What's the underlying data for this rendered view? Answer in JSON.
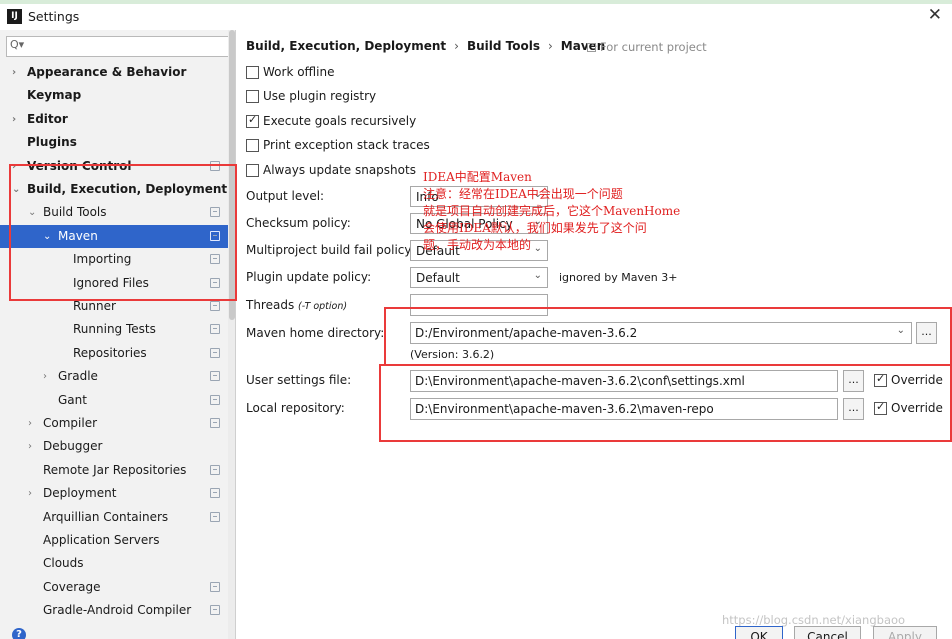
{
  "window": {
    "title": "Settings",
    "app_icon": "IJ"
  },
  "sidebar": {
    "search_placeholder": "Q▾",
    "items": [
      {
        "label": "Appearance & Behavior",
        "bold": true,
        "arrow": "›",
        "level": 0
      },
      {
        "label": "Keymap",
        "bold": true,
        "level": 0
      },
      {
        "label": "Editor",
        "bold": true,
        "arrow": "›",
        "level": 0
      },
      {
        "label": "Plugins",
        "bold": true,
        "level": 0
      },
      {
        "label": "Version Control",
        "bold": true,
        "arrow": "›",
        "level": 0,
        "project": true
      },
      {
        "label": "Build, Execution, Deployment",
        "bold": true,
        "arrow": "⌄",
        "level": 0
      },
      {
        "label": "Build Tools",
        "arrow": "⌄",
        "level": 1,
        "project": true
      },
      {
        "label": "Maven",
        "arrow": "⌄",
        "level": 2,
        "project": true,
        "selected": true
      },
      {
        "label": "Importing",
        "level": 3,
        "project": true
      },
      {
        "label": "Ignored Files",
        "level": 3,
        "project": true
      },
      {
        "label": "Runner",
        "level": 3,
        "project": true
      },
      {
        "label": "Running Tests",
        "level": 3,
        "project": true
      },
      {
        "label": "Repositories",
        "level": 3,
        "project": true
      },
      {
        "label": "Gradle",
        "arrow": "›",
        "level": 2,
        "project": true
      },
      {
        "label": "Gant",
        "level": 2,
        "project": true
      },
      {
        "label": "Compiler",
        "arrow": "›",
        "level": 1,
        "project": true
      },
      {
        "label": "Debugger",
        "arrow": "›",
        "level": 1
      },
      {
        "label": "Remote Jar Repositories",
        "level": 1,
        "project": true
      },
      {
        "label": "Deployment",
        "arrow": "›",
        "level": 1,
        "project": true
      },
      {
        "label": "Arquillian Containers",
        "level": 1,
        "project": true
      },
      {
        "label": "Application Servers",
        "level": 1
      },
      {
        "label": "Clouds",
        "level": 1
      },
      {
        "label": "Coverage",
        "level": 1,
        "project": true
      },
      {
        "label": "Gradle-Android Compiler",
        "level": 1,
        "project": true
      }
    ]
  },
  "breadcrumb": {
    "parts": [
      "Build, Execution, Deployment",
      "Build Tools",
      "Maven"
    ],
    "separator": "›",
    "note": "For current project"
  },
  "options": [
    {
      "label": "Work offline",
      "checked": false
    },
    {
      "label": "Use plugin registry",
      "checked": false
    },
    {
      "label": "Execute goals recursively",
      "checked": true
    },
    {
      "label": "Print exception stack traces",
      "checked": false
    },
    {
      "label": "Always update snapshots",
      "checked": false
    }
  ],
  "fields": {
    "output_level": {
      "label": "Output level:",
      "value": "Info"
    },
    "checksum_policy": {
      "label": "Checksum policy:",
      "value": "No Global Policy"
    },
    "multiproject_policy": {
      "label": "Multiproject build fail policy:",
      "value": "Default"
    },
    "plugin_update_policy": {
      "label": "Plugin update policy:",
      "value": "Default",
      "note": "ignored by Maven 3+"
    },
    "threads": {
      "label": "Threads",
      "hint": "(-T option)",
      "value": ""
    },
    "maven_home": {
      "label": "Maven home directory:",
      "value": "D:/Environment/apache-maven-3.6.2",
      "version": "(Version: 3.6.2)"
    },
    "user_settings": {
      "label": "User settings file:",
      "value": "D:\\Environment\\apache-maven-3.6.2\\conf\\settings.xml",
      "override_label": "Override",
      "override": true
    },
    "local_repo": {
      "label": "Local repository:",
      "value": "D:\\Environment\\apache-maven-3.6.2\\maven-repo",
      "override_label": "Override",
      "override": true
    }
  },
  "browse_label": "...",
  "annotation": "IDEA中配置Maven\n注意：经常在IDEA中会出现一个问题\n就是项目自动创建完成后，它这个MavenHome\n会使用IDEA默认，我们如果发先了这个问\n题，手动改为本地的",
  "buttons": {
    "ok": "OK",
    "cancel": "Cancel",
    "apply": "Apply",
    "help": "?"
  },
  "watermark": "https://blog.csdn.net/xiangbaoo",
  "colors": {
    "selection": "#2f65ca",
    "annotation_red": "#ea3a3a"
  }
}
